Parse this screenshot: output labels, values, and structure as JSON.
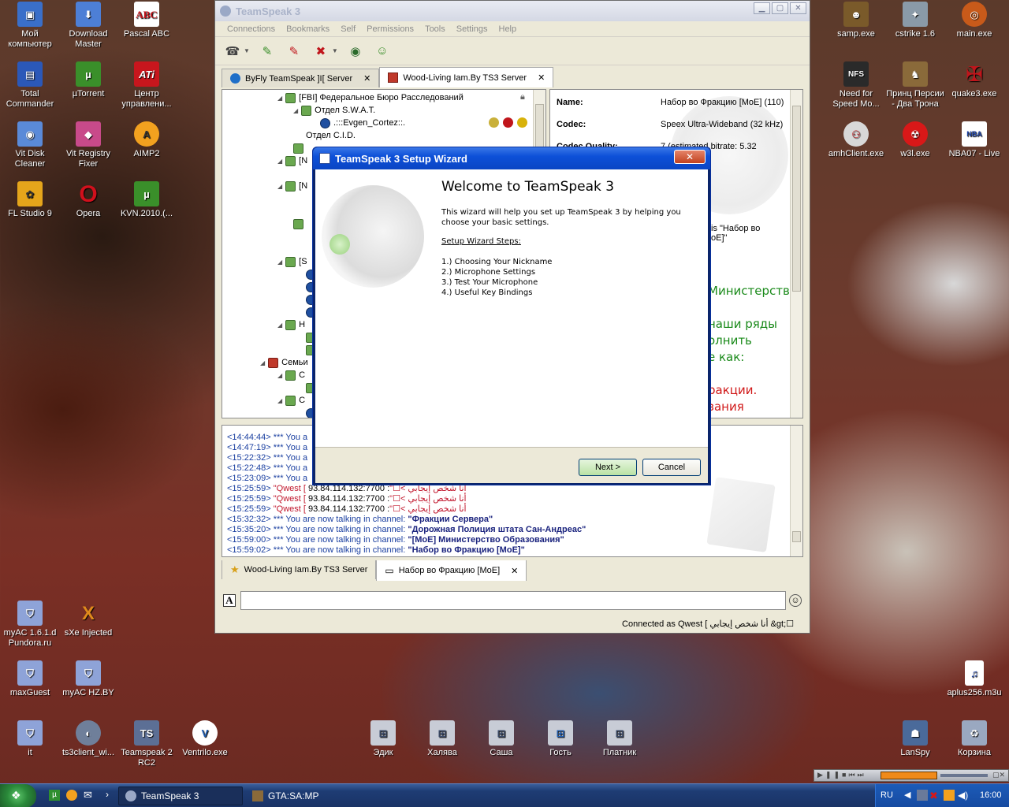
{
  "desktop": {
    "left_icons": [
      {
        "label": "Мой компьютер",
        "icon": "computer-icon",
        "color": "#3a6fc9"
      },
      {
        "label": "Download Master",
        "icon": "download-icon",
        "color": "#4d7fd6"
      },
      {
        "label": "Pascal ABC",
        "icon": "abc-icon",
        "color": "#ffffff"
      },
      {
        "label": "Total Commander",
        "icon": "floppy-icon",
        "color": "#2b58b8"
      },
      {
        "label": "µTorrent",
        "icon": "utorrent-icon",
        "color": "#3a8f2a"
      },
      {
        "label": "Центр управлени...",
        "icon": "ati-icon",
        "color": "#c8161d"
      },
      {
        "label": "Vit Disk Cleaner",
        "icon": "disk-icon",
        "color": "#5a8ad8"
      },
      {
        "label": "Vit Registry Fixer",
        "icon": "registry-icon",
        "color": "#c84a8a"
      },
      {
        "label": "AIMP2",
        "icon": "aimp-icon",
        "color": "#f2a11f"
      },
      {
        "label": "FL Studio 9",
        "icon": "flstudio-icon",
        "color": "#e5a51b"
      },
      {
        "label": "Opera",
        "icon": "opera-icon",
        "color": "#d0101c"
      },
      {
        "label": "KVN.2010.(...",
        "icon": "utorrent-icon",
        "color": "#3a8f2a"
      },
      {
        "label": "myAC 1.6.1.d Pundora.ru",
        "icon": "shield-icon",
        "color": "#8ea3d8"
      },
      {
        "label": "sXe Injected",
        "icon": "sxe-icon",
        "color": "#e08a1c"
      },
      {
        "label": "maxGuest",
        "icon": "shield-icon",
        "color": "#8ea3d8"
      },
      {
        "label": "myAC HZ.BY",
        "icon": "shield-icon",
        "color": "#8ea3d8"
      },
      {
        "label": "it",
        "icon": "shield-icon",
        "color": "#8ea3d8"
      },
      {
        "label": "ts3client_wi...",
        "icon": "ts3-icon",
        "color": "#6f7f9a"
      },
      {
        "label": "Teamspeak 2 RC2",
        "icon": "ts2-icon",
        "color": "#5c6f95"
      },
      {
        "label": "Ventrilo.exe",
        "icon": "ventrilo-icon",
        "color": "#1f5fb5"
      }
    ],
    "right_icons": [
      {
        "label": "samp.exe",
        "icon": "samp-icon",
        "color": "#7a5a2a"
      },
      {
        "label": "cstrike 1.6",
        "icon": "cstrike-icon",
        "color": "#8a9aa8"
      },
      {
        "label": "main.exe",
        "icon": "main-icon",
        "color": "#c85a1a"
      },
      {
        "label": "Need for Speed Mo...",
        "icon": "nfs-icon",
        "color": "#2a2a2a"
      },
      {
        "label": "Принц Персии - Два Трона",
        "icon": "prince-icon",
        "color": "#8a6a3a"
      },
      {
        "label": "quake3.exe",
        "icon": "quake-icon",
        "color": "#c0151b"
      },
      {
        "label": "amhClient.exe",
        "icon": "amh-icon",
        "color": "#d8d8d8"
      },
      {
        "label": "w3l.exe",
        "icon": "w3l-icon",
        "color": "#d81818"
      },
      {
        "label": "NBA07 - Live",
        "icon": "nba-icon",
        "color": "#ffffff"
      },
      {
        "label": "aplus256.m3u",
        "icon": "playlist-icon",
        "color": "#ffffff"
      },
      {
        "label": "LanSpy",
        "icon": "lanspy-icon",
        "color": "#4a6a9a"
      },
      {
        "label": "Корзина",
        "icon": "recycle-bin-icon",
        "color": "#9aa8c0"
      }
    ],
    "bottom_icons": [
      {
        "label": "Эдик",
        "icon": "network-share-icon"
      },
      {
        "label": "Халява",
        "icon": "network-share-icon"
      },
      {
        "label": "Саша",
        "icon": "network-share-icon"
      },
      {
        "label": "Гость",
        "icon": "network-share-icon"
      },
      {
        "label": "Платник",
        "icon": "network-share-icon"
      }
    ]
  },
  "ts_window": {
    "title": "TeamSpeak 3",
    "menu": [
      "Connections",
      "Bookmarks",
      "Self",
      "Permissions",
      "Tools",
      "Settings",
      "Help"
    ],
    "server_tabs": [
      {
        "label": "ByFly TeamSpeak ]I[ Server"
      },
      {
        "label": "Wood-Living Iam.By TS3 Server"
      }
    ],
    "tree": [
      {
        "label": "[FBI] Федеральное Бюро Расследований"
      },
      {
        "label": "Отдел S.W.A.T."
      },
      {
        "label": ".:::Evgen_Cortez::."
      },
      {
        "label": "Отдел C.I.D."
      },
      {
        "label": "[N"
      },
      {
        "label": "[N"
      },
      {
        "label": "[S"
      },
      {
        "label": "H"
      },
      {
        "label": "Семьи"
      },
      {
        "label": "C"
      },
      {
        "label": "C"
      }
    ],
    "info": {
      "name_key": "Name:",
      "name_value": "Набор во Фракцию [MoE] (110)",
      "codec_key": "Codec:",
      "codec_value": "Speex Ultra-Wideband (32 kHz)",
      "quality_key": "Codec Quality:",
      "quality_value": "7 (estimated bitrate: 5.32",
      "desc1": "is \"Набор во",
      "desc2": "oE]\"",
      "green1": "Министерство",
      "green2": "наши ряды",
      "green3": "олнить",
      "green4": "е как:",
      "red1": "ракции.",
      "red2": "зания"
    },
    "chat": [
      {
        "time": "<14:44:44>",
        "text": "*** You a"
      },
      {
        "time": "<14:47:19>",
        "text": "*** You a"
      },
      {
        "time": "<15:22:32>",
        "text": "*** You a"
      },
      {
        "time": "<15:22:48>",
        "text": "*** You a"
      },
      {
        "time": "<15:23:09>",
        "text": "*** You a"
      },
      {
        "time": "<15:25:59>",
        "nick": "\"Qwest [ أنا شخص إيجابي >☐\"",
        "text": ": 93.84.114.132:7700"
      },
      {
        "time": "<15:25:59>",
        "nick": "\"Qwest [ أنا شخص إيجابي >☐\"",
        "text": ": 93.84.114.132:7700"
      },
      {
        "time": "<15:25:59>",
        "nick": "\"Qwest [ أنا شخص إيجابي >☐\"",
        "text": ": 93.84.114.132:7700"
      },
      {
        "time": "<15:32:32>",
        "text": "*** You are now talking in channel: ",
        "channel": "\"Фракции Сервера\""
      },
      {
        "time": "<15:35:20>",
        "text": "*** You are now talking in channel: ",
        "channel": "\"Дорожная Полиция штата Сан-Андреас\""
      },
      {
        "time": "<15:59:00>",
        "text": "*** You are now talking in channel: ",
        "channel": "\"[MoE] Министерство Образования\""
      },
      {
        "time": "<15:59:02>",
        "text": "*** You are now talking in channel: ",
        "channel": "\"Набор во Фракцию [MoE]\""
      }
    ],
    "chat_tabs": [
      {
        "label": "Wood-Living Iam.By TS3 Server"
      },
      {
        "label": "Набор во Фракцию [MoE]"
      }
    ],
    "status": "Connected as Qwest [ أنا شخص إيجابي &gt;☐"
  },
  "wizard": {
    "title": "TeamSpeak 3 Setup Wizard",
    "heading": "Welcome to TeamSpeak 3",
    "intro": "This wizard will help you set up TeamSpeak 3 by helping you choose your basic settings.",
    "steps_heading": "Setup Wizard Steps:",
    "steps": [
      "1.) Choosing Your Nickname",
      "2.) Microphone Settings",
      "3.) Test Your Microphone",
      "4.) Useful Key Bindings"
    ],
    "next_label": "Next >",
    "cancel_label": "Cancel"
  },
  "taskbar": {
    "items": [
      {
        "label": "TeamSpeak 3"
      },
      {
        "label": "GTA:SA:MP"
      }
    ],
    "lang": "RU",
    "clock": "16:00"
  }
}
